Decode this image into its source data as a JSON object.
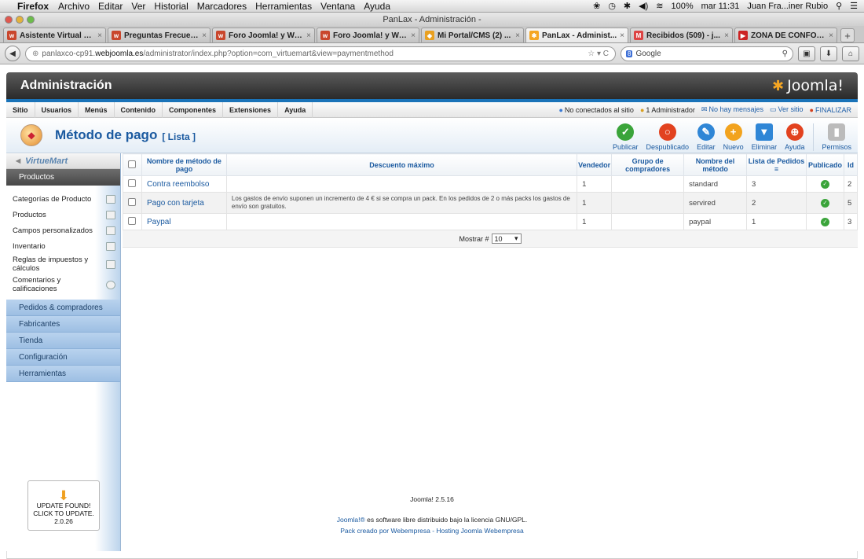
{
  "macbar": {
    "app": "Firefox",
    "menus": [
      "Archivo",
      "Editar",
      "Ver",
      "Historial",
      "Marcadores",
      "Herramientas",
      "Ventana",
      "Ayuda"
    ],
    "battery": "100%",
    "clock": "mar 11:31",
    "user": "Juan Fra...iner Rubio"
  },
  "window": {
    "title": "PanLax - Administración -"
  },
  "tabs": [
    {
      "label": "Asistente Virtual S...",
      "fav": "w",
      "color": "#c9462c"
    },
    {
      "label": "Preguntas Frecuen...",
      "fav": "w",
      "color": "#c9462c"
    },
    {
      "label": "Foro Joomla! y Wo...",
      "fav": "w",
      "color": "#c9462c"
    },
    {
      "label": "Foro Joomla! y Wo...",
      "fav": "w",
      "color": "#c9462c"
    },
    {
      "label": "Mi Portal/CMS (2) ...",
      "fav": "◆",
      "color": "#e9a020"
    },
    {
      "label": "PanLax - Administ...",
      "fav": "✱",
      "color": "#f5a623",
      "active": true
    },
    {
      "label": "Recibidos (509) - j...",
      "fav": "M",
      "color": "#d44"
    },
    {
      "label": "ZONA DE CONFOR...",
      "fav": "▶",
      "color": "#c22"
    }
  ],
  "urlbar": {
    "pre": "panlaxco-cp91.",
    "domain": "webjoomla.es",
    "path": "/administrator/index.php?option=com_virtuemart&view=paymentmethod",
    "reload": "☆ ▾ C"
  },
  "search": {
    "engine": "8",
    "placeholder": "Google"
  },
  "admin": {
    "title": "Administración",
    "logo": "Joomla!",
    "menu": [
      "Sitio",
      "Usuarios",
      "Menús",
      "Contenido",
      "Componentes",
      "Extensiones",
      "Ayuda"
    ],
    "status": {
      "connected": "No conectados al sitio",
      "admins": "1 Administrador",
      "messages": "No hay mensajes",
      "view_site": "Ver sitio",
      "logout": "FINALIZAR"
    }
  },
  "toolbar": {
    "title": "Método de pago",
    "subtitle": "[ Lista ]",
    "buttons": [
      {
        "label": "Publicar",
        "color": "#3aa43a",
        "glyph": "✓"
      },
      {
        "label": "Despublicado",
        "color": "#e2421f",
        "glyph": "○"
      },
      {
        "label": "Editar",
        "color": "#2f86d6",
        "glyph": "✎"
      },
      {
        "label": "Nuevo",
        "color": "#f2a31e",
        "glyph": "+"
      },
      {
        "label": "Eliminar",
        "color": "#2f86d6",
        "glyph": "▼"
      },
      {
        "label": "Ayuda",
        "color": "#e2421f",
        "glyph": "⊕"
      }
    ],
    "permissions": "Permisos"
  },
  "sidebar": {
    "logo": "VirtueMart",
    "section_products": "Productos",
    "items": [
      "Categorías de Producto",
      "Productos",
      "Campos personalizados",
      "Inventario",
      "Reglas de impuestos y cálculos",
      "Comentarios y calificaciones"
    ],
    "sections": [
      "Pedidos & compradores",
      "Fabricantes",
      "Tienda",
      "Configuración",
      "Herramientas"
    ],
    "update": {
      "l1": "UPDATE FOUND!",
      "l2": "CLICK TO UPDATE.",
      "l3": "2.0.26"
    }
  },
  "table": {
    "headers": {
      "name": "Nombre de método de pago",
      "discount": "Descuento máximo",
      "vendor": "Vendedor",
      "group": "Grupo de compradores",
      "method": "Nombre del método",
      "order": "Lista de Pedidos",
      "published": "Publicado",
      "id": "Id"
    },
    "rows": [
      {
        "name": "Contra reembolso",
        "desc": "",
        "vendor": "1",
        "group": "",
        "method": "standard",
        "order": "3",
        "id": "2"
      },
      {
        "name": "Pago con tarjeta",
        "desc": "Los gastos de envío suponen un incremento de 4 € si se compra un pack. En los pedidos de 2 o más packs los gastos de envío son gratuitos.",
        "vendor": "1",
        "group": "",
        "method": "servired",
        "order": "2",
        "id": "5"
      },
      {
        "name": "Paypal",
        "desc": "",
        "vendor": "1",
        "group": "",
        "method": "paypal",
        "order": "1",
        "id": "3"
      }
    ],
    "show_label": "Mostrar #",
    "show_value": "10"
  },
  "footer": {
    "version": "Joomla! 2.5.16",
    "line1_link": "Joomla!®",
    "line1_text": " es software libre distribuido bajo la licencia GNU/GPL.",
    "line2": "Pack creado por Webempresa - Hosting Joomla Webempresa"
  }
}
